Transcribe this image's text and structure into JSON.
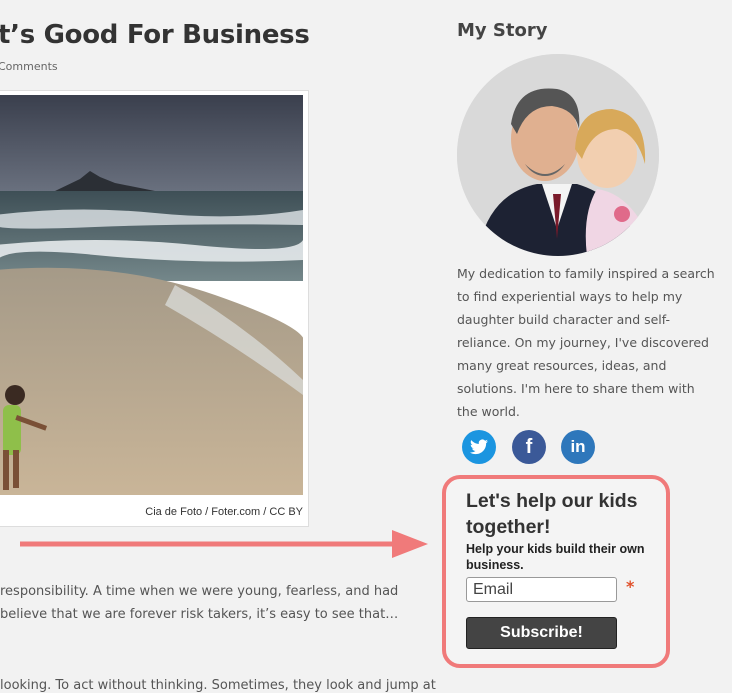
{
  "post": {
    "title": "t’s Good For Business",
    "meta": "Comments",
    "photo_alt": "child running on a beach",
    "credit": {
      "author": "Cia de Foto",
      "sep1": " / ",
      "site": "Foter.com",
      "sep2": " / ",
      "license": "CC BY"
    },
    "paragraph_lines": [
      "responsibility. A time when we were young, fearless, and had",
      " believe that we are forever risk takers, it’s easy to see that…",
      "looking. To act without thinking. Sometimes, they look and jump at"
    ]
  },
  "sidebar": {
    "heading": "My Story",
    "avatar_alt": "father and daughter portrait",
    "bio": "My dedication to family inspired a search to find experiential ways to help my daughter build character and self-reliance. On my journey, I've discovered many great resources, ideas, and solutions. I'm here to share them with the world.",
    "social": [
      {
        "name": "twitter",
        "icon": "twitter-icon"
      },
      {
        "name": "facebook",
        "icon": "facebook-icon",
        "glyph": "f"
      },
      {
        "name": "linkedin",
        "icon": "linkedin-icon",
        "glyph": "in"
      }
    ]
  },
  "optin": {
    "title": "Let's help our kids together!",
    "subtitle": "Help your kids build their own business.",
    "email_placeholder": "Email",
    "required_mark": "*",
    "button": "Subscribe!"
  },
  "colors": {
    "highlight": "#f07a7a",
    "twitter": "#1b95e0",
    "facebook": "#3b5998",
    "linkedin": "#2e77bb",
    "button": "#444444"
  }
}
